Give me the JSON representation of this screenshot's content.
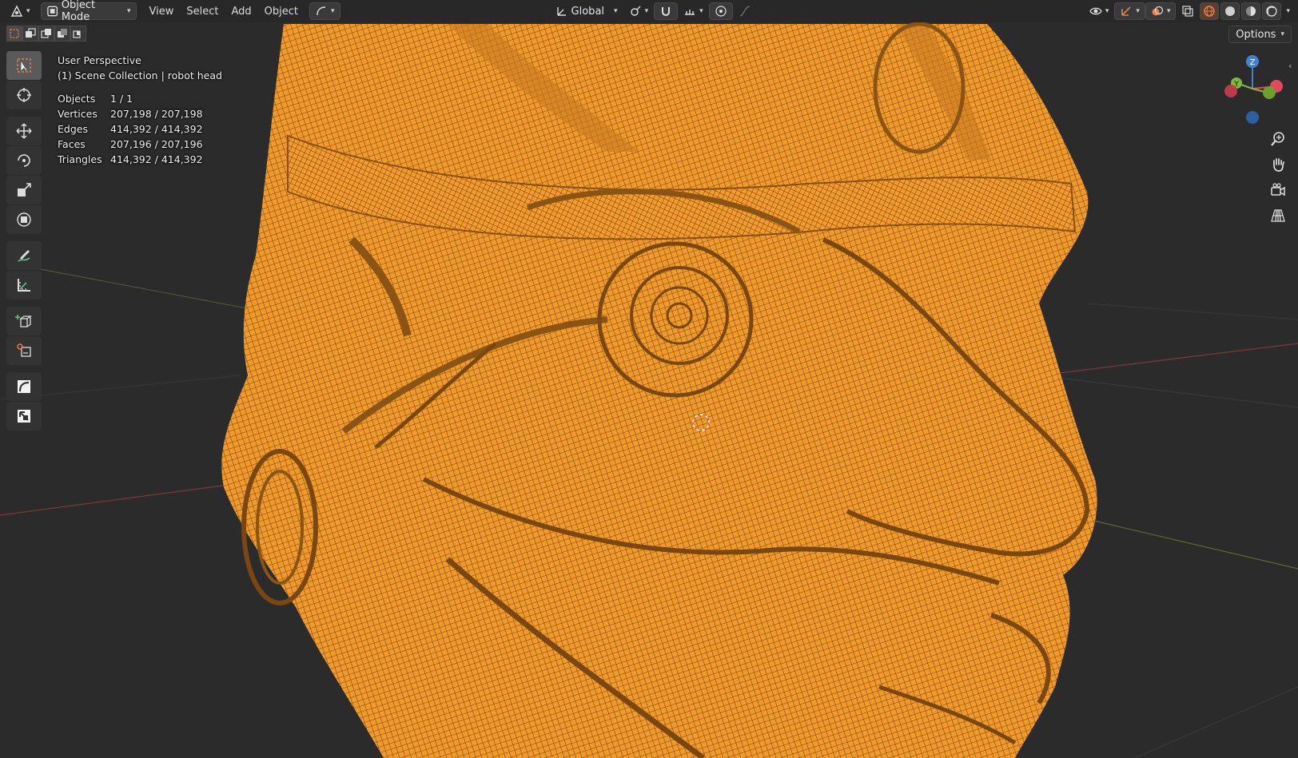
{
  "header": {
    "mode_label": "Object Mode",
    "menus": [
      "View",
      "Select",
      "Add",
      "Object"
    ],
    "transform_orientation": "Global"
  },
  "subrow": {
    "options_label": "Options"
  },
  "overlay": {
    "view_name": "User Perspective",
    "collection_line": "(1) Scene Collection | robot head",
    "stats": [
      {
        "label": "Objects",
        "value": "1 / 1"
      },
      {
        "label": "Vertices",
        "value": "207,198 / 207,198"
      },
      {
        "label": "Edges",
        "value": "414,392 / 414,392"
      },
      {
        "label": "Faces",
        "value": "207,196 / 207,196"
      },
      {
        "label": "Triangles",
        "value": "414,392 / 414,392"
      }
    ]
  },
  "gizmo": {
    "axis_z": "Z",
    "axis_y": "Y",
    "color_x": "#e04a5f",
    "color_y": "#82b83c",
    "color_z": "#3f82d6"
  },
  "colors": {
    "mesh": "#f0962a",
    "mesh_dark": "#b86a18",
    "background": "#2b2b2b",
    "active_tool": "#5a5a5a"
  },
  "toolbar_icons": [
    "select-box-icon",
    "cursor-icon",
    "move-icon",
    "rotate-icon",
    "scale-icon",
    "transform-icon",
    "annotate-icon",
    "measure-icon",
    "add-cube-icon",
    "add-object-icon",
    "shear-icon",
    "bend-icon"
  ],
  "nav_icons": [
    "zoom-icon",
    "pan-hand-icon",
    "camera-view-icon",
    "ortho-grid-icon"
  ]
}
